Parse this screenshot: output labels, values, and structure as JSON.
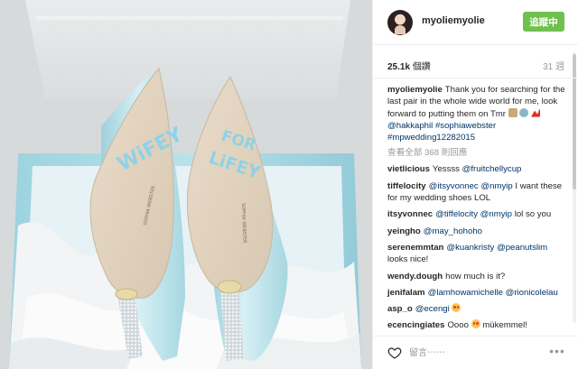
{
  "post": {
    "username": "myoliemyolie",
    "follow_label": "追蹤中",
    "views_count": "25.1k",
    "views_label": "個讚",
    "date": "31 週",
    "view_all_label": "查看全部 368 則回應"
  },
  "caption": {
    "user": "myoliemyolie",
    "text_before": "Thank you for searching for the last pair in the whole wide world for me, look forward to putting them on Tmr",
    "mention": "@hakkaphil",
    "tags": "#sophiawebster #mpwedding12282015"
  },
  "comments": [
    {
      "user": "vietlicious",
      "text": "Yessss",
      "mentions": "@fruitchellycup"
    },
    {
      "user": "tiffelocity",
      "mentions": "@itsyvonnec @nmyip",
      "text": "I want these for my wedding shoes LOL"
    },
    {
      "user": "itsyvonnec",
      "mentions": "@tiffelocity @nmyip",
      "text": "lol so you"
    },
    {
      "user": "yeingho",
      "mentions": "@may_hohoho",
      "text": ""
    },
    {
      "user": "serenemmtan",
      "mentions": "@kuankristy @peanutslim",
      "text": "looks nice!"
    },
    {
      "user": "wendy.dough",
      "mentions": "",
      "text": "how much is it?"
    },
    {
      "user": "jenifalam",
      "mentions": "@lamhowamichelle @rionicolelau",
      "text": ""
    },
    {
      "user": "asp_o",
      "mentions": "@ecengi",
      "text": ""
    },
    {
      "user": "ecencingiates",
      "mentions": "",
      "text": "Oooo",
      "text_after": "mükemmel!"
    }
  ],
  "footer": {
    "comment_placeholder": "留言⋯⋯",
    "more_label": "•••"
  },
  "shoe_text": {
    "left": "WiFEY",
    "right": "FOR LiFEY",
    "brand": "SOPHIA WEBSTER"
  },
  "icons": {
    "heart": "heart-icon",
    "more": "more-options-icon"
  },
  "colors": {
    "follow_bg": "#70c050",
    "link": "#003569",
    "shoe_blue": "#bfe4ec",
    "box_blue": "#9fd6e3"
  }
}
